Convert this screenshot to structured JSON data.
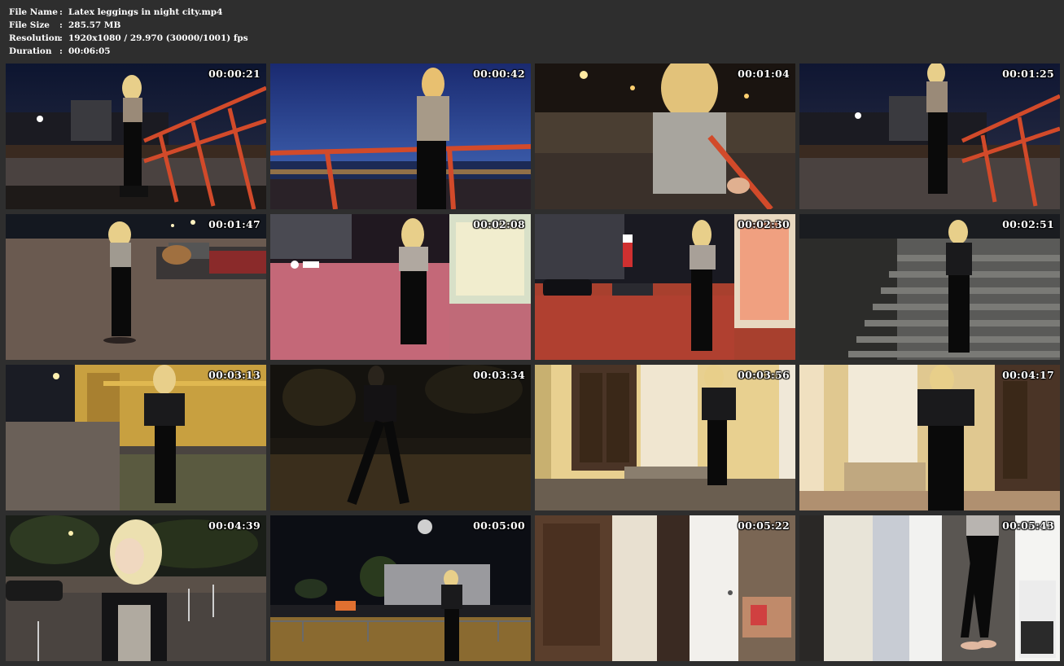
{
  "file_info": {
    "rows": [
      {
        "label": "File Name",
        "sep": ":",
        "value": "Latex leggings in night city.mp4"
      },
      {
        "label": "File Size",
        "sep": ":",
        "value": "285.57 MB"
      },
      {
        "label": "Resolution",
        "sep": ":",
        "value": "1920x1080 / 29.970 (30000/1001) fps"
      },
      {
        "label": "Duration",
        "sep": ":",
        "value": "00:06:05"
      }
    ]
  },
  "thumbnails": [
    {
      "timestamp": "00:00:21",
      "scene": "night-embankment-red-railing"
    },
    {
      "timestamp": "00:00:42",
      "scene": "dusk-river-red-railing"
    },
    {
      "timestamp": "00:01:04",
      "scene": "closeup-railing-night"
    },
    {
      "timestamp": "00:01:25",
      "scene": "night-embankment-red-railing"
    },
    {
      "timestamp": "00:01:47",
      "scene": "night-street-parked-cars"
    },
    {
      "timestamp": "00:02:08",
      "scene": "pink-lit-sidewalk"
    },
    {
      "timestamp": "00:02:30",
      "scene": "red-lit-street-storefront"
    },
    {
      "timestamp": "00:02:51",
      "scene": "stone-stairs-night"
    },
    {
      "timestamp": "00:03:13",
      "scene": "yellow-building-street"
    },
    {
      "timestamp": "00:03:34",
      "scene": "dark-park"
    },
    {
      "timestamp": "00:03:56",
      "scene": "doorway-columns"
    },
    {
      "timestamp": "00:04:17",
      "scene": "doorway-columns-closeup"
    },
    {
      "timestamp": "00:04:39",
      "scene": "tree-lined-road-night"
    },
    {
      "timestamp": "00:05:00",
      "scene": "moonlit-plaza"
    },
    {
      "timestamp": "00:05:22",
      "scene": "apartment-door"
    },
    {
      "timestamp": "00:05:43",
      "scene": "apartment-hallway"
    }
  ]
}
